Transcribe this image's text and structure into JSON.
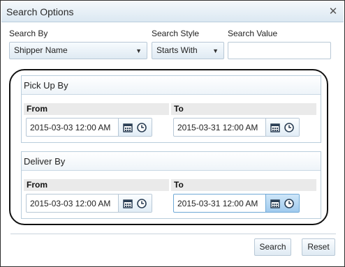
{
  "dialog": {
    "title": "Search Options"
  },
  "filters": {
    "search_by_label": "Search By",
    "search_by_value": "Shipper Name",
    "search_style_label": "Search Style",
    "search_style_value": "Starts With",
    "search_value_label": "Search Value",
    "search_value": ""
  },
  "pickup": {
    "header": "Pick Up By",
    "from_label": "From",
    "from_value": "2015-03-03 12:00 AM",
    "to_label": "To",
    "to_value": "2015-03-31 12:00 AM"
  },
  "deliver": {
    "header": "Deliver By",
    "from_label": "From",
    "from_value": "2015-03-03 12:00 AM",
    "to_label": "To",
    "to_value": "2015-03-31 12:00 AM"
  },
  "buttons": {
    "search": "Search",
    "reset": "Reset"
  },
  "icons": {
    "close": "close-icon",
    "calendar": "calendar-icon",
    "clock": "clock-icon",
    "dropdown": "chevron-down-icon"
  },
  "colors": {
    "titlebar": "#dbe8f2",
    "accent": "#9fcaee",
    "highlight_outline": "#111111"
  }
}
